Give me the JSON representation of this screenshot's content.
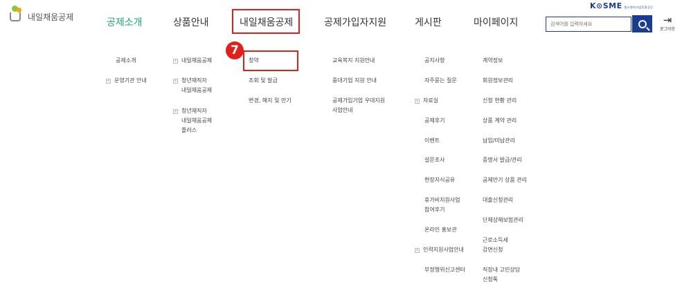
{
  "logo": {
    "text": "내일채움공제"
  },
  "brand": {
    "kosme": "K⊙SME",
    "kosme_sub": "중소벤처기업진흥공단"
  },
  "nav": [
    {
      "label": "공제소개"
    },
    {
      "label": "상품안내"
    },
    {
      "label": "내일채움공제"
    },
    {
      "label": "공제가입자지원"
    },
    {
      "label": "게시판"
    },
    {
      "label": "마이페이지"
    }
  ],
  "search": {
    "placeholder": "검색어를 입력하세요"
  },
  "logout": {
    "label": "로그아웃"
  },
  "annotation": {
    "step": "7"
  },
  "menu": {
    "col1": [
      "공제소개",
      "운영기관 안내"
    ],
    "col2": [
      "내일채움공제",
      "청년재직자\n내일채움공제",
      "청년재직자\n내일채움공제\n플러스"
    ],
    "col3": [
      "청약",
      "조회 및 발급",
      "변경, 해지 및 만기"
    ],
    "col4": [
      "교육복지 지원안내",
      "중대기업 지원 안내",
      "공제가입기업 우대지원\n사업안내"
    ],
    "col5": [
      "공지사항",
      "자주묻는 질문",
      "자료실",
      "공제후기",
      "이벤트",
      "설문조사",
      "현장지식공유",
      "휴가비지원사업\n참여후기",
      "온라인 홍보관",
      "인력지원사업안내",
      "부정행위신고센터"
    ],
    "col6": [
      "계약정보",
      "회원정보관리",
      "신청 현황 관리",
      "상품 계약 관리",
      "납입/미납관리",
      "증명서 발급/관리",
      "공제만기 상품 관리",
      "대출신청관리",
      "단체상해보험관리",
      "근로소득세\n감면신청",
      "직장내 고민상담\n신청톡"
    ]
  },
  "colors": {
    "accent_green": "#1aa67a",
    "brand_blue": "#1b3d8f",
    "highlight_red": "#e0201b"
  }
}
